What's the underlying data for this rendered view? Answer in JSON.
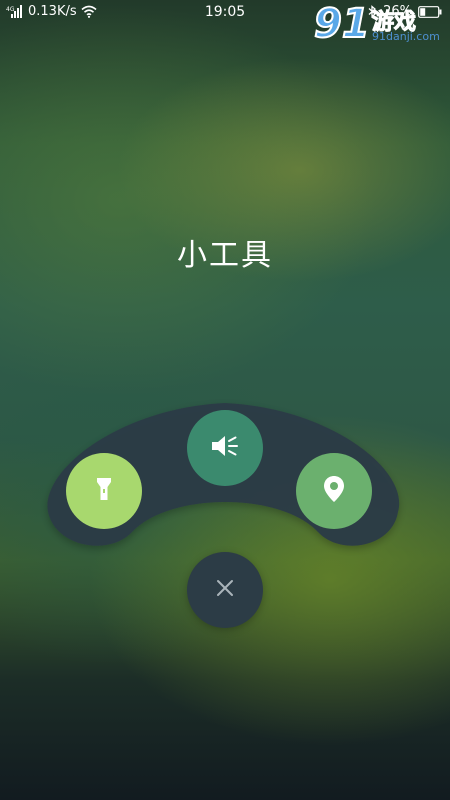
{
  "status_bar": {
    "signal_label": "4G",
    "network_speed": "0.13K/s",
    "time": "19:05",
    "battery_percent": "26%",
    "icons": [
      "signal-icon",
      "wifi-icon",
      "bluetooth-icon",
      "battery-icon"
    ]
  },
  "watermark": {
    "brand_number": "91",
    "brand_text": "游戏",
    "url": "91danji.com"
  },
  "page": {
    "title": "小工具"
  },
  "tools": [
    {
      "name": "flashlight",
      "icon": "flashlight-icon",
      "color": "#a8d86e"
    },
    {
      "name": "sound",
      "icon": "speaker-icon",
      "color": "#3b8a6e"
    },
    {
      "name": "location",
      "icon": "location-pin-icon",
      "color": "#6bb06e"
    }
  ],
  "close_button": {
    "icon": "close-icon",
    "color": "#2c3c46"
  },
  "colors": {
    "tray": "#2c3c46",
    "text": "#ffffff"
  }
}
